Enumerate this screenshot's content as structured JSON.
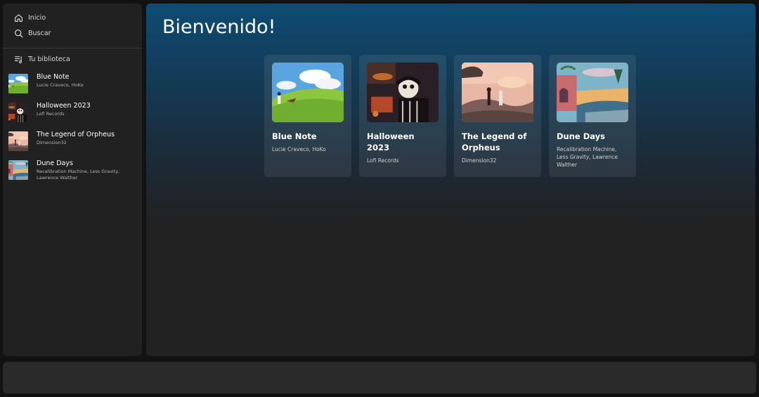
{
  "sidebar": {
    "nav": [
      {
        "label": "Inicio",
        "icon": "home-icon"
      },
      {
        "label": "Buscar",
        "icon": "search-icon"
      }
    ],
    "library_label": "Tu biblioteca",
    "library_icon": "library-icon",
    "items": [
      {
        "title": "Blue Note",
        "subtitle": "Lucie Craveco, HoKo"
      },
      {
        "title": "Halloween 2023",
        "subtitle": "Lofi Records"
      },
      {
        "title": "The Legend of Orpheus",
        "subtitle": "Dimension32"
      },
      {
        "title": "Dune Days",
        "subtitle": "Recalibration Machine, Less Gravity, Lawrence Walther"
      }
    ]
  },
  "main": {
    "heading": "Bienvenido!",
    "cards": [
      {
        "title": "Blue Note",
        "subtitle": "Lucie Craveco, HoKo"
      },
      {
        "title": "Halloween 2023",
        "subtitle": "Lofi Records"
      },
      {
        "title": "The Legend of Orpheus",
        "subtitle": "Dimension32"
      },
      {
        "title": "Dune Days",
        "subtitle": "Recalibration Machine, Less Gravity, Lawrence Walther"
      }
    ]
  },
  "colors": {
    "background": "#121212",
    "panel": "#212121",
    "accent_gradient_top": "#0e4c74",
    "player_bar": "#2a2a2a"
  }
}
